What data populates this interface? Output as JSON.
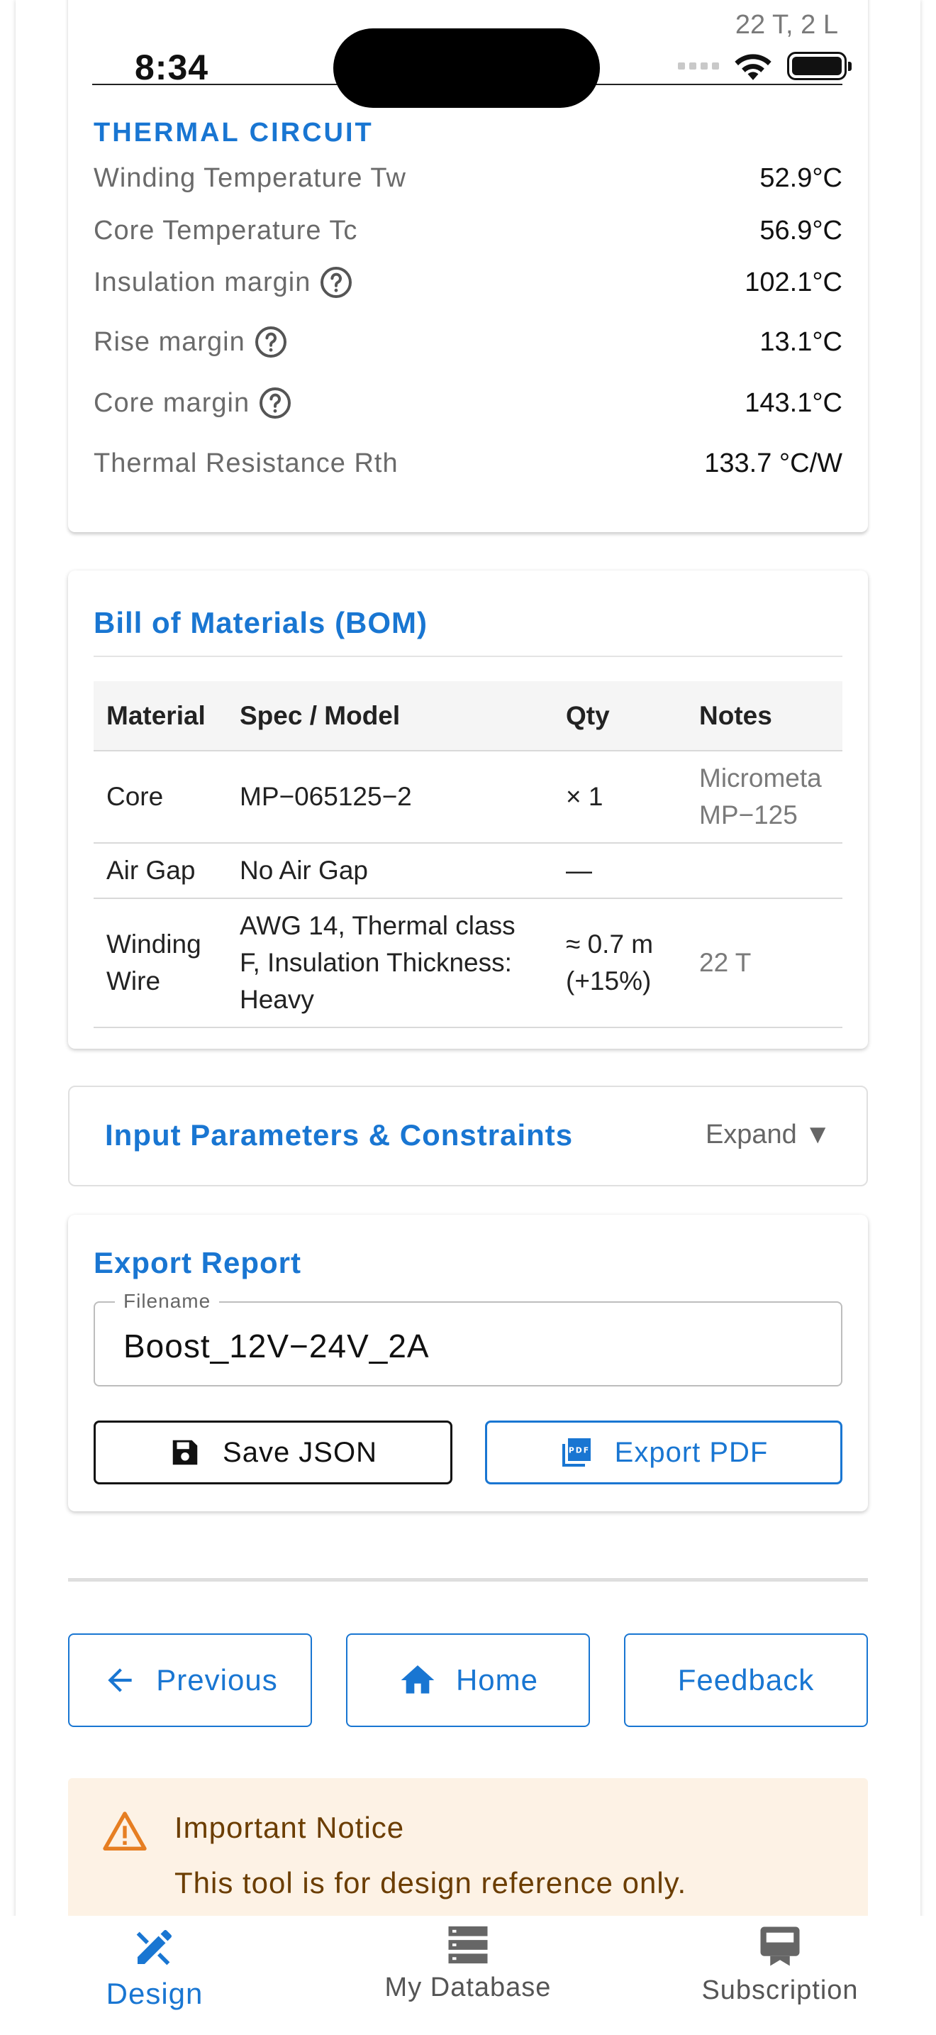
{
  "status_bar": {
    "time": "8:34",
    "cutoff_text": "22 T, 2 L"
  },
  "thermal": {
    "heading": "THERMAL CIRCUIT",
    "rows": [
      {
        "label": "Winding Temperature Tw",
        "value": "52.9°C",
        "help": false
      },
      {
        "label": "Core Temperature Tc",
        "value": "56.9°C",
        "help": false
      },
      {
        "label": "Insulation margin",
        "value": "102.1°C",
        "help": true
      },
      {
        "label": "Rise margin",
        "value": "13.1°C",
        "help": true
      },
      {
        "label": "Core margin",
        "value": "143.1°C",
        "help": true
      },
      {
        "label": "Thermal Resistance Rth",
        "value": "133.7 °C/W",
        "help": false
      }
    ]
  },
  "bom": {
    "title": "Bill of Materials (BOM)",
    "columns": [
      "Material",
      "Spec / Model",
      "Qty",
      "Notes"
    ],
    "rows": [
      {
        "material": "Core",
        "spec": "MP−065125−2",
        "qty": "× 1",
        "notes": "Micrometa MP−125"
      },
      {
        "material": "Air Gap",
        "spec": "No Air Gap",
        "qty": "—",
        "notes": ""
      },
      {
        "material": "Winding Wire",
        "spec": "AWG 14, Thermal class F, Insulation Thickness: Heavy",
        "qty": "≈ 0.7 m (+15%)",
        "notes": "22 T"
      }
    ]
  },
  "input_params": {
    "title": "Input Parameters & Constraints",
    "toggle_label": "Expand ▼"
  },
  "export": {
    "title": "Export Report",
    "filename_label": "Filename",
    "filename_value": "Boost_12V−24V_2A",
    "save_label": "Save JSON",
    "pdf_label": "Export PDF"
  },
  "nav": {
    "previous": "Previous",
    "home": "Home",
    "feedback": "Feedback"
  },
  "notice": {
    "title": "Important Notice",
    "text": "This tool is for design reference only."
  },
  "tabbar": {
    "design": "Design",
    "database": "My Database",
    "subscription": "Subscription"
  },
  "colors": {
    "accent": "#1976d2",
    "notice_bg": "#fdf2e5",
    "notice_text": "#6b3d00",
    "warning_icon": "#e67e22"
  }
}
